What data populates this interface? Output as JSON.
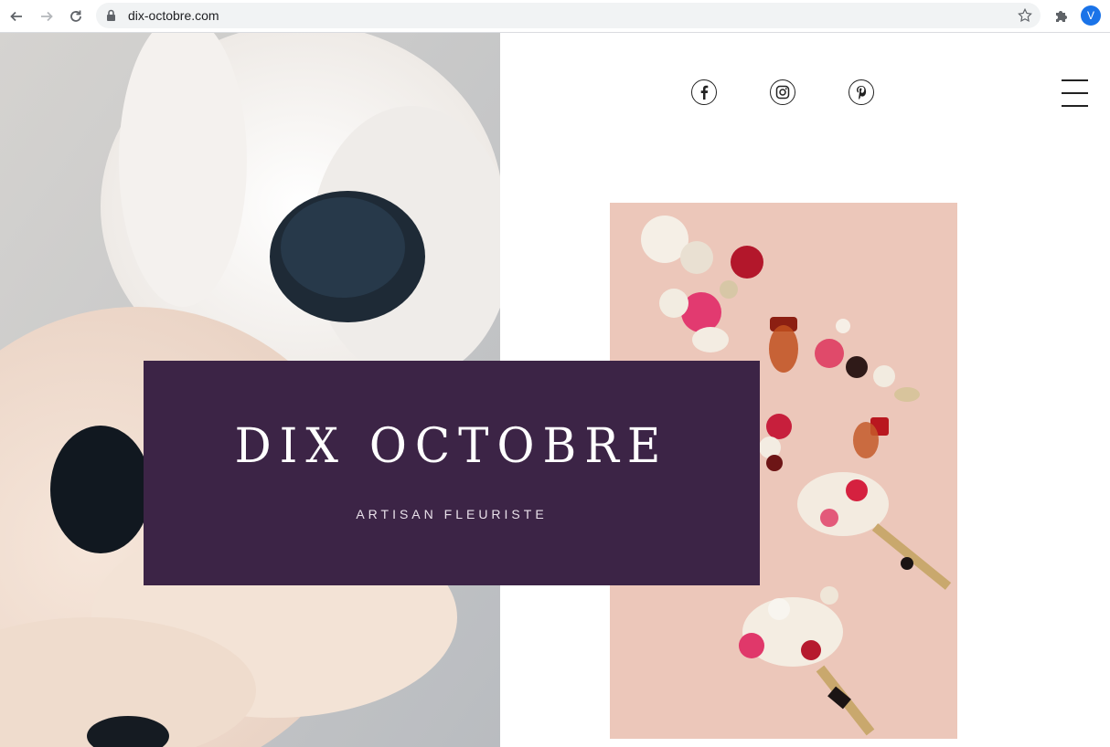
{
  "browser": {
    "url": "dix-octobre.com",
    "profile_initial": "V",
    "icons": [
      "back-arrow-icon",
      "forward-arrow-icon",
      "reload-icon",
      "lock-icon",
      "star-icon",
      "puzzle-icon"
    ]
  },
  "social": {
    "items": [
      "facebook-icon",
      "instagram-icon",
      "pinterest-icon"
    ]
  },
  "brand": {
    "title": "DIX OCTOBRE",
    "subtitle": "ARTISAN FLEURISTE"
  },
  "colors": {
    "panel": "#3c2446",
    "bouquet_background": "#ecc7ba"
  }
}
